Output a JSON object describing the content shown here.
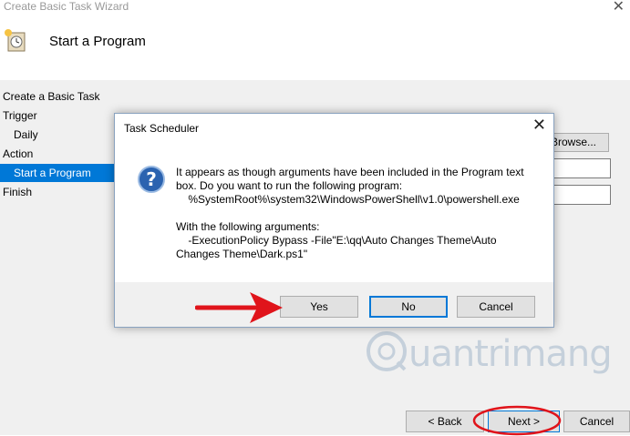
{
  "window": {
    "title": "Create Basic Task Wizard",
    "close_glyph": "✕"
  },
  "header": {
    "title": "Start a Program",
    "icon": "clock-icon"
  },
  "steps": [
    {
      "label": "Create a Basic Task"
    },
    {
      "label": "Trigger"
    },
    {
      "label": "Daily"
    },
    {
      "label": "Action"
    },
    {
      "label": "Start a Program"
    },
    {
      "label": "Finish"
    }
  ],
  "form": {
    "browse_label": "Browse..."
  },
  "dialog": {
    "title": "Task Scheduler",
    "close_glyph": "✕",
    "icon": "question-icon",
    "message_lines": [
      "It appears as though arguments have been included in the Program text",
      "box. Do you want to run the following program:",
      "    %SystemRoot%\\system32\\WindowsPowerShell\\v1.0\\powershell.exe",
      "",
      "With the following arguments:",
      "    -ExecutionPolicy Bypass -File\"E:\\qq\\Auto Changes Theme\\Auto",
      "Changes Theme\\Dark.ps1\""
    ],
    "buttons": {
      "yes": "Yes",
      "no": "No",
      "cancel": "Cancel"
    }
  },
  "footer": {
    "back": "< Back",
    "next": "Next >",
    "cancel": "Cancel"
  },
  "watermark": {
    "text": "uantrimang"
  },
  "colors": {
    "selection": "#0078d7",
    "annotation": "#e0141b",
    "dialog_icon": "#2b63b0"
  }
}
